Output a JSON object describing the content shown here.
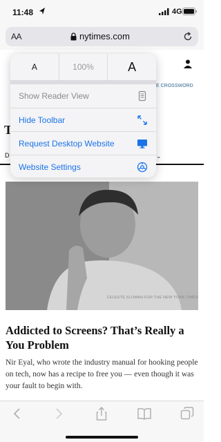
{
  "status_bar": {
    "time": "11:48",
    "network": "4G"
  },
  "address_bar": {
    "text_size_button": "AA",
    "url": "nytimes.com"
  },
  "popover": {
    "zoom_decrease": "A",
    "zoom_level": "100%",
    "zoom_increase": "A",
    "items": [
      {
        "label": "Show Reader View",
        "icon": "reader-view-icon",
        "enabled": false
      },
      {
        "label": "Hide Toolbar",
        "icon": "expand-arrows-icon",
        "enabled": true
      },
      {
        "label": "Request Desktop Website",
        "icon": "desktop-icon",
        "enabled": true
      },
      {
        "label": "Website Settings",
        "icon": "settings-gear-icon",
        "enabled": true
      }
    ]
  },
  "page": {
    "crossword_link": "E CROSSWORD",
    "partial_title": "T",
    "partial_nav": "D",
    "photo_credit": "CELESTE SLOMAN FOR THE NEW YORK TIMES",
    "headline": "Addicted to Screens? That’s Really a You Problem",
    "summary": "Nir Eyal, who wrote the industry manual for hooking people on tech, now has a recipe to free you — even though it was your fault to begin with."
  },
  "toolbar": {
    "buttons": [
      "back-icon",
      "forward-icon",
      "share-icon",
      "bookmarks-icon",
      "tabs-icon"
    ]
  },
  "colors": {
    "accent": "#1a73e8",
    "disabled": "#8a8a8a"
  }
}
